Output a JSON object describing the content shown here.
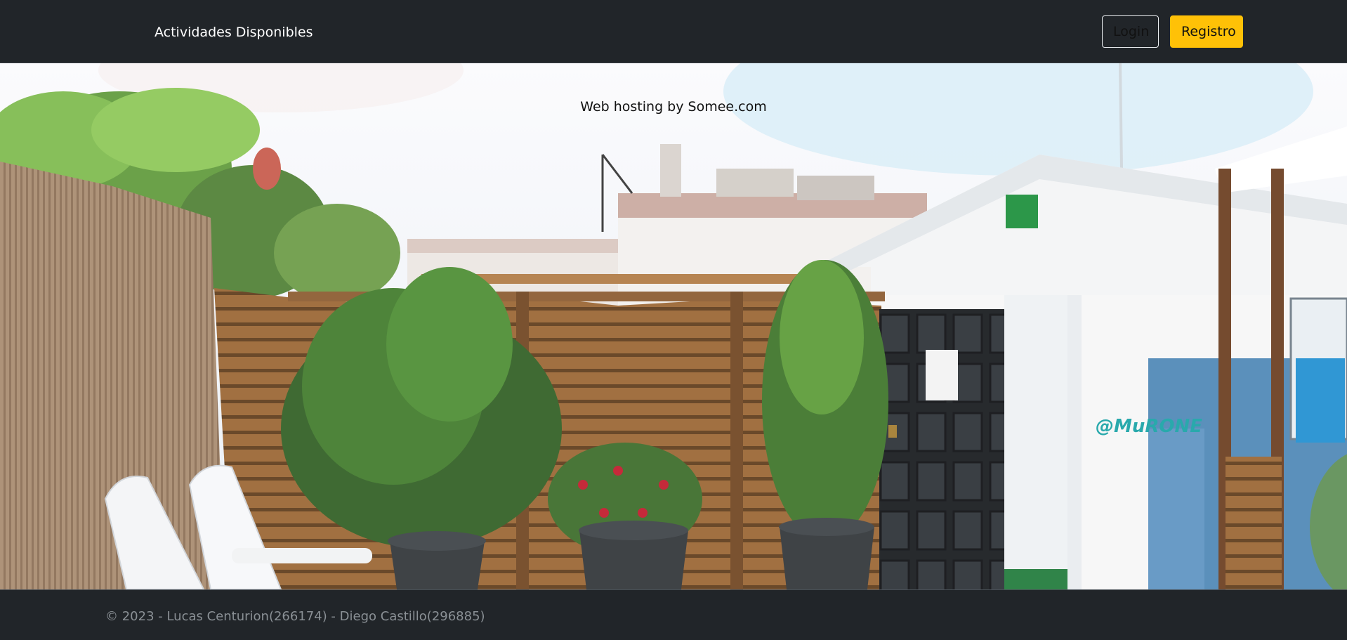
{
  "navbar": {
    "brand": "Actividades Disponibles",
    "login_label": "Login",
    "registro_label": "Registro"
  },
  "hero": {
    "hosting_text": "Web hosting by Somee.com",
    "graffiti_text": "@MuRONE"
  },
  "footer": {
    "copyright": "© 2023 - Lucas Centurion(266174) - Diego Castillo(296885)"
  },
  "colors": {
    "navbar_bg": "#212529",
    "registro_bg": "#ffc107",
    "footer_text": "#8a9095"
  }
}
